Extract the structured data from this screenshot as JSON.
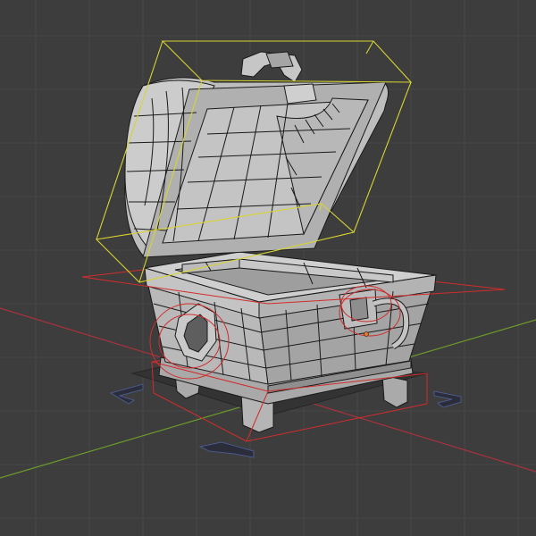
{
  "viewport": {
    "mode": "3d-viewport",
    "background_color": "#3d3d3d",
    "grid_color": "#464646",
    "x_axis_color": "#a8323d",
    "y_axis_color": "#6c9a2b"
  },
  "scene": {
    "object": "treasure-chest",
    "shading": "wireframe-over-solid",
    "mesh_color": "#c8c8c8",
    "wire_color": "#1a1a1a",
    "selection": {
      "lid_bounds_color": "#d7d431",
      "base_bounds_color": "#d22c2c"
    },
    "gizmo_marker_color": "#2b2d3a"
  }
}
